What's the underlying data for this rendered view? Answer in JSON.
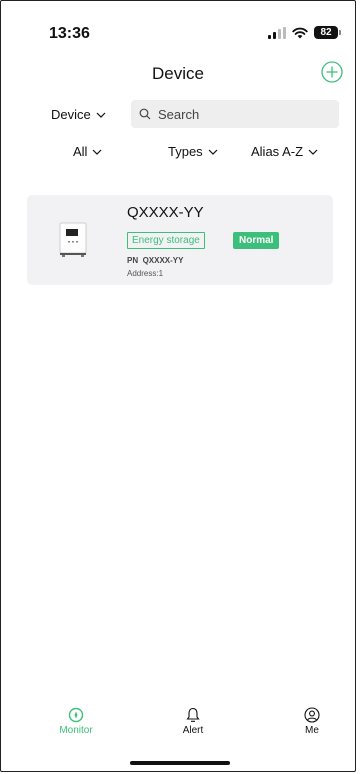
{
  "status_bar": {
    "time": "13:36",
    "battery": "82",
    "icons": [
      "signal-icon",
      "wifi-icon",
      "battery-icon"
    ]
  },
  "header": {
    "title": "Device",
    "add_icon": "plus-circle-icon"
  },
  "filters": {
    "device_dropdown": "Device",
    "search_placeholder": "Search",
    "all": "All",
    "types": "Types",
    "sort": "Alias A-Z"
  },
  "devices": [
    {
      "name": "QXXXX-YY",
      "type_tag": "Energy storage",
      "status": "Normal",
      "pn_label": "PN",
      "pn_value": "QXXXX-YY",
      "address": "Address:1"
    }
  ],
  "tabbar": {
    "monitor": "Monitor",
    "alert": "Alert",
    "me": "Me",
    "active": "monitor"
  },
  "colors": {
    "accent": "#3cbf7a",
    "card_bg": "#f2f2f4",
    "search_bg": "#eeeeee"
  }
}
